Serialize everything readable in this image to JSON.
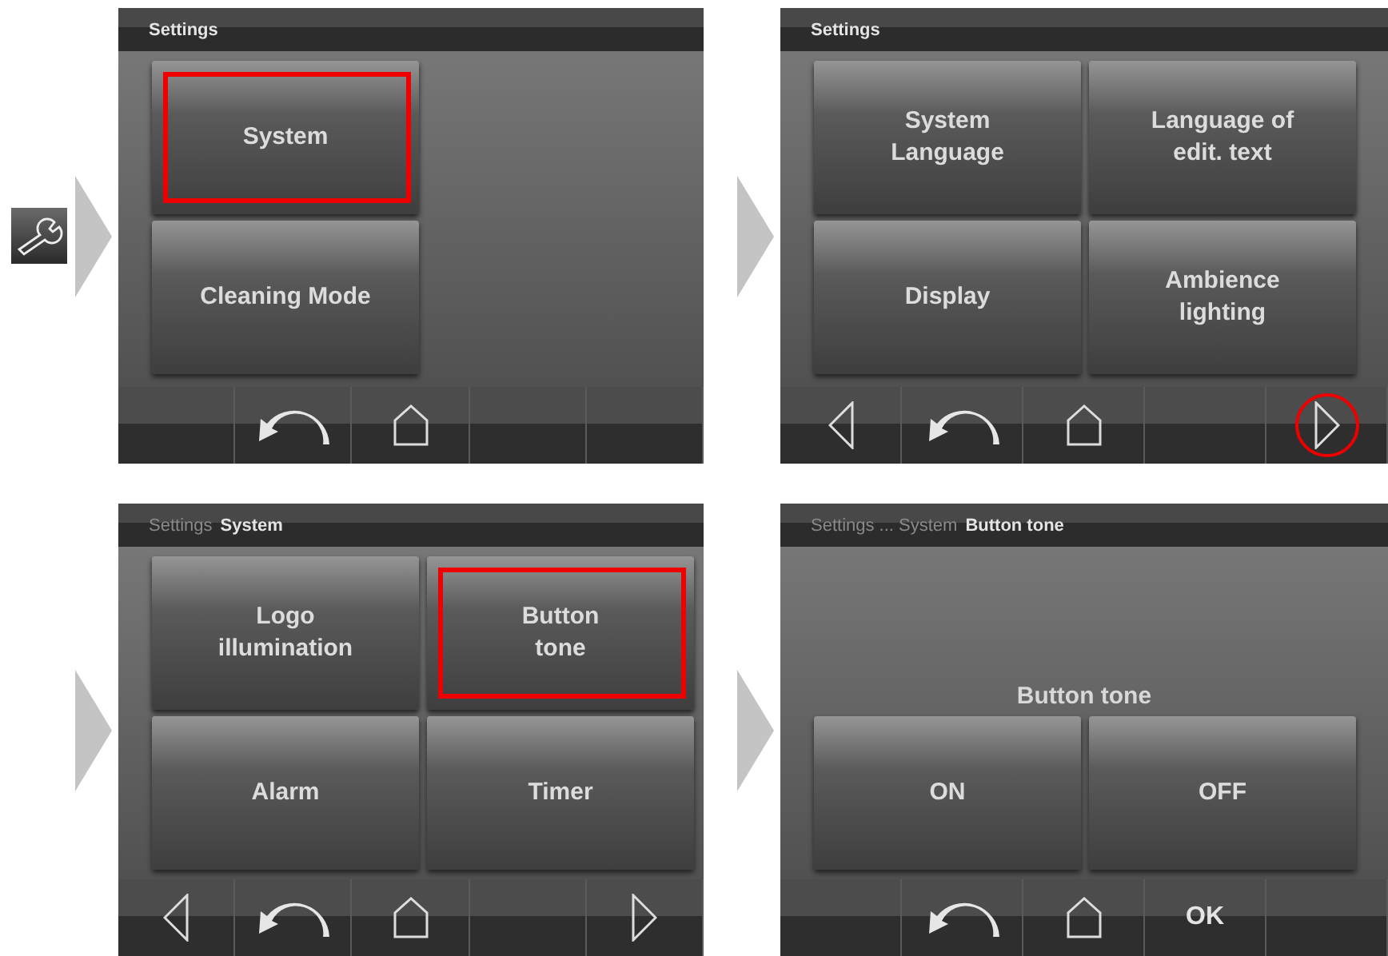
{
  "screens": [
    {
      "tool_icon": true,
      "breadcrumb": [
        {
          "text": "Settings",
          "current": true
        }
      ],
      "tile_rows": [
        [
          {
            "label": "System",
            "highlighted": true
          }
        ],
        [
          {
            "label": "Cleaning Mode",
            "highlighted": false
          }
        ]
      ],
      "nav": [
        {
          "kind": "empty",
          "circled": false
        },
        {
          "kind": "back",
          "circled": false
        },
        {
          "kind": "home",
          "circled": false
        },
        {
          "kind": "empty",
          "circled": false
        },
        {
          "kind": "empty",
          "circled": false
        }
      ]
    },
    {
      "breadcrumb": [
        {
          "text": "Settings",
          "current": true
        }
      ],
      "tile_rows": [
        [
          {
            "label": "System\nLanguage",
            "highlighted": false
          },
          {
            "label": "Language of\nedit. text",
            "highlighted": false
          }
        ],
        [
          {
            "label": "Display",
            "highlighted": false
          },
          {
            "label": "Ambience\nlighting",
            "highlighted": false
          }
        ]
      ],
      "nav": [
        {
          "kind": "prev",
          "circled": false
        },
        {
          "kind": "back",
          "circled": false
        },
        {
          "kind": "home",
          "circled": false
        },
        {
          "kind": "empty",
          "circled": false
        },
        {
          "kind": "next",
          "circled": true
        }
      ]
    },
    {
      "breadcrumb": [
        {
          "text": "Settings",
          "current": false
        },
        {
          "text": "System",
          "current": true
        }
      ],
      "tile_rows": [
        [
          {
            "label": "Logo\nillumination",
            "highlighted": false
          },
          {
            "label": "Button\ntone",
            "highlighted": true
          }
        ],
        [
          {
            "label": "Alarm",
            "highlighted": false
          },
          {
            "label": "Timer",
            "highlighted": false
          }
        ]
      ],
      "nav": [
        {
          "kind": "prev",
          "circled": false
        },
        {
          "kind": "back",
          "circled": false
        },
        {
          "kind": "home",
          "circled": false
        },
        {
          "kind": "empty",
          "circled": false
        },
        {
          "kind": "next",
          "circled": false
        }
      ]
    },
    {
      "breadcrumb": [
        {
          "text": "Settings ... System",
          "current": false
        },
        {
          "text": "Button tone",
          "current": true
        }
      ],
      "prompt": "Button tone",
      "tile_rows": [
        [
          {
            "label": "ON",
            "highlighted": false
          },
          {
            "label": "OFF",
            "highlighted": false
          }
        ]
      ],
      "nav": [
        {
          "kind": "empty",
          "circled": false
        },
        {
          "kind": "back",
          "circled": false
        },
        {
          "kind": "home",
          "circled": false
        },
        {
          "kind": "ok",
          "label": "OK",
          "circled": false
        },
        {
          "kind": "empty",
          "circled": false
        }
      ]
    }
  ]
}
